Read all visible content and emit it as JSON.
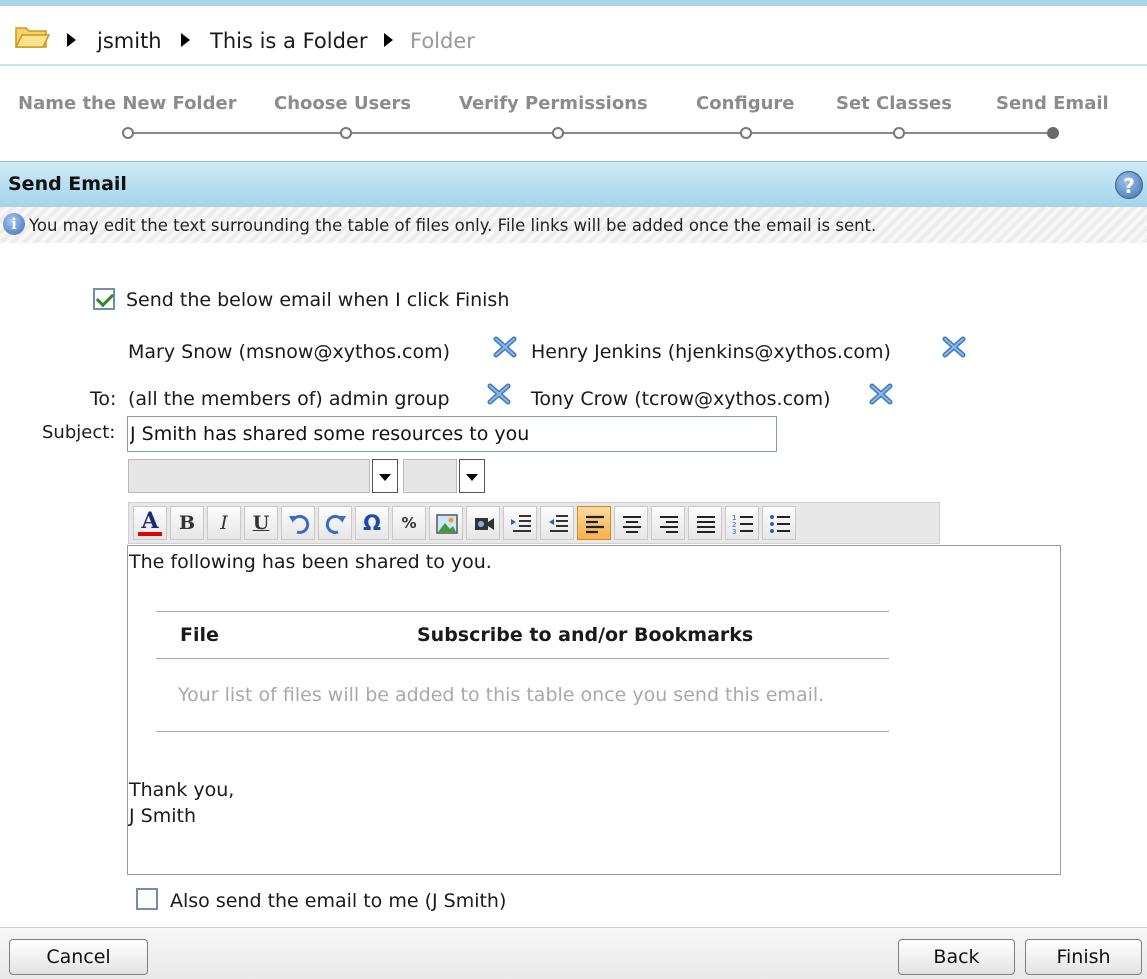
{
  "breadcrumb": {
    "items": [
      "jsmith",
      "This is a Folder",
      "Folder"
    ]
  },
  "wizard": {
    "steps": [
      "Name the New Folder",
      "Choose Users",
      "Verify Permissions",
      "Configure",
      "Set Classes",
      "Send Email"
    ],
    "current_step": 6
  },
  "section": {
    "title": "Send Email",
    "info": "You may edit the text surrounding the table of files only. File links will be added once the email is sent."
  },
  "send_checkbox": {
    "label": "Send the below email when I click Finish",
    "checked": true
  },
  "recipients": {
    "to_label": "To:",
    "items": [
      "Mary Snow (msnow@xythos.com)",
      "Henry Jenkins (hjenkins@xythos.com)",
      "(all the members of) admin group",
      "Tony Crow (tcrow@xythos.com)"
    ]
  },
  "subject": {
    "label": "Subject:",
    "value": "J Smith has shared some resources to you"
  },
  "editor": {
    "intro": "The following has been shared to you.",
    "table_headers": [
      "File",
      "Subscribe to and/or Bookmarks"
    ],
    "table_placeholder": "Your list of files will be added to this table once you send this email.",
    "closing": "Thank you,",
    "signature": "J Smith"
  },
  "copy_checkbox": {
    "label": "Also send the email to me (J Smith)",
    "checked": false
  },
  "buttons": {
    "cancel": "Cancel",
    "back": "Back",
    "finish": "Finish"
  },
  "colors": {
    "header_blue": "#a4d4ea",
    "active_tool": "#f6b14d",
    "remove_blue": "#3d7bbf"
  }
}
